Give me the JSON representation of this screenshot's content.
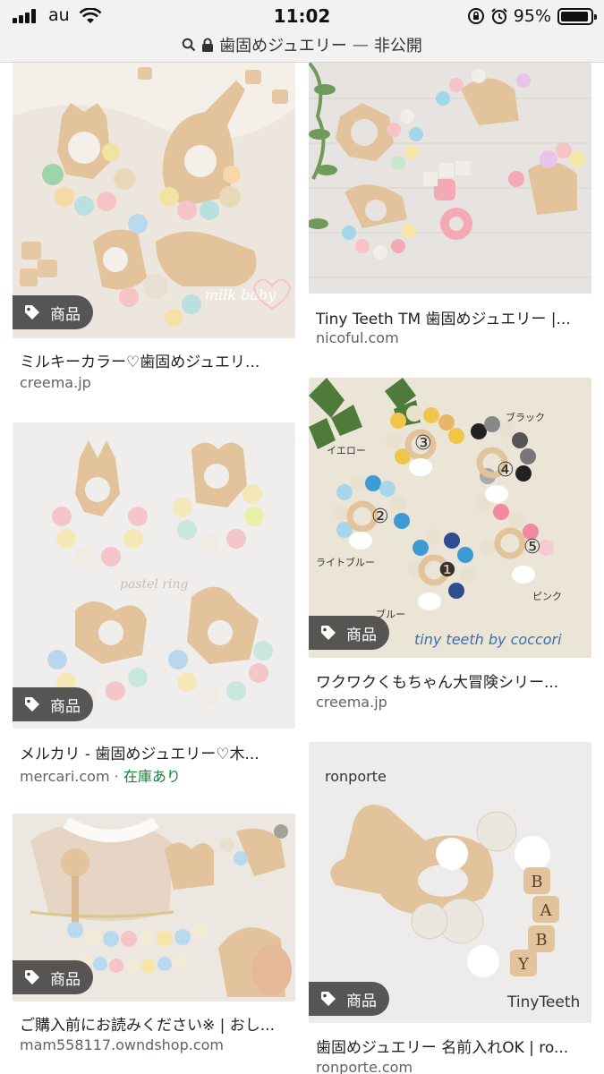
{
  "status_bar": {
    "carrier": "au",
    "time": "11:02",
    "battery": "95%",
    "battery_level": 0.95
  },
  "address_bar": {
    "query": "歯固めジュエリー",
    "separator": "—",
    "visibility": "非公開"
  },
  "badge_label": "商品",
  "results": [
    {
      "title": "ミルキーカラー♡歯固めジュエリ...",
      "domain": "creema.jp",
      "watermark": "milk baby"
    },
    {
      "title": "Tiny Teeth TM 歯固めジュエリー |...",
      "domain": "nicoful.com"
    },
    {
      "title": "メルカリ - 歯固めジュエリー♡木...",
      "domain": "mercari.com",
      "dot": " · ",
      "stock": "在庫あり",
      "watermark": "pastel ring"
    },
    {
      "title": "ワクワクくもちゃん大冒険シリー...",
      "domain": "creema.jp",
      "watermark": "tiny teeth by coccori",
      "labels": [
        "イエロー",
        "ブラック",
        "ライトブルー",
        "ピンク",
        "ブルー"
      ],
      "numbers": [
        "③",
        "④",
        "②",
        "⑤",
        "❶"
      ]
    },
    {
      "title": "ご購入前にお読みください※ | おし...",
      "domain": "mam558117.owndshop.com"
    },
    {
      "title": "歯固めジュエリー 名前入れOK | ro...",
      "domain": "ronporte.com",
      "brand_top": "ronporte",
      "brand_bottom": "TinyTeeth",
      "letters": [
        "B",
        "A",
        "B",
        "Y"
      ]
    }
  ],
  "colors": {
    "bar_bg": "#f2f2f2",
    "badge_bg": "#343434",
    "stock_green": "#188038",
    "wood": "#e3c39b"
  }
}
